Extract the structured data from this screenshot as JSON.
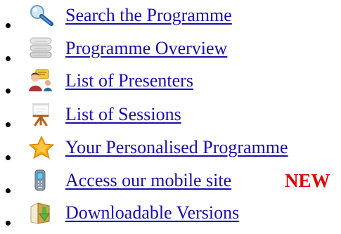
{
  "menu": {
    "items": [
      {
        "label": "Search the Programme",
        "icon": "search-icon"
      },
      {
        "label": "Programme Overview",
        "icon": "document-stack-icon"
      },
      {
        "label": "List of Presenters",
        "icon": "presenter-icon"
      },
      {
        "label": "List of Sessions",
        "icon": "flipchart-icon"
      },
      {
        "label": "Your Personalised Programme",
        "icon": "star-icon"
      },
      {
        "label": "Access our mobile site",
        "icon": "mobile-phone-icon",
        "badge": "NEW"
      },
      {
        "label": "Downloadable Versions",
        "icon": "download-icon"
      }
    ]
  },
  "colors": {
    "link": "#1a0dab",
    "badge": "#e00000",
    "star": "#f5a300",
    "download_arrow": "#53b83a"
  }
}
